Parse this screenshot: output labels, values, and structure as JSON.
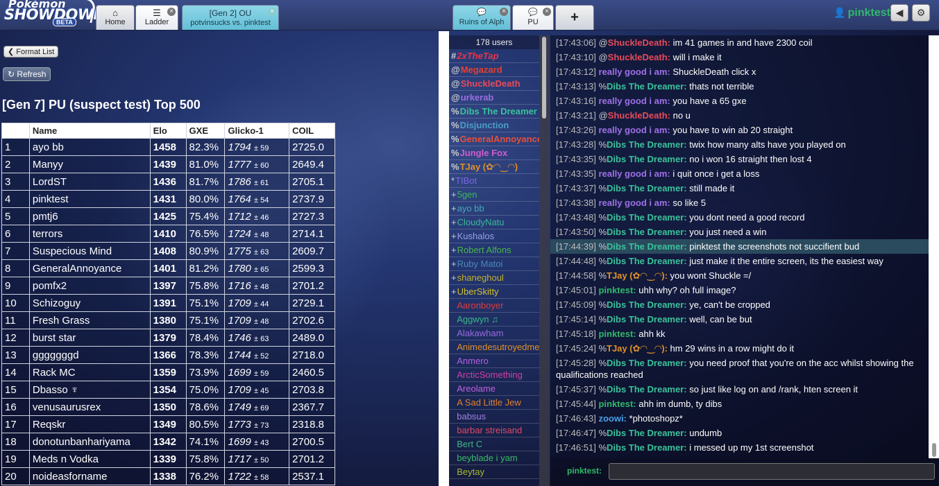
{
  "header": {
    "logo_line1": "Pokémon",
    "logo_line2": "SHOWDOWN",
    "logo_badge": "BETA",
    "tabs": [
      {
        "label": "Home",
        "icon": "⌂"
      },
      {
        "label": "Ladder",
        "icon": "☰"
      },
      {
        "label_top": "[Gen 2] OU",
        "label_bottom": "potvinsucks vs. pinktest"
      },
      {
        "label": "Ruins of Alph",
        "icon": "💬"
      },
      {
        "label": "PU",
        "icon": "💬"
      },
      {
        "icon": "+"
      }
    ],
    "username": "pinktest"
  },
  "ladder": {
    "format_list": "Format List",
    "refresh": "Refresh",
    "title": "[Gen 7] PU (suspect test) Top 500",
    "columns": [
      "",
      "Name",
      "Elo",
      "GXE",
      "Glicko-1",
      "COIL"
    ],
    "rows": [
      [
        "1",
        "ayo bb",
        "1458",
        "82.3%",
        "1794",
        "± 59",
        "2725.0"
      ],
      [
        "2",
        "Manyy",
        "1439",
        "81.0%",
        "1777",
        "± 60",
        "2649.4"
      ],
      [
        "3",
        "LordST",
        "1436",
        "81.7%",
        "1786",
        "± 61",
        "2705.1"
      ],
      [
        "4",
        "pinktest",
        "1431",
        "80.0%",
        "1764",
        "± 54",
        "2737.9"
      ],
      [
        "5",
        "pmtj6",
        "1425",
        "75.4%",
        "1712",
        "± 46",
        "2727.3"
      ],
      [
        "6",
        "terrors",
        "1410",
        "76.5%",
        "1724",
        "± 48",
        "2714.1"
      ],
      [
        "7",
        "Suspecious Mind",
        "1408",
        "80.9%",
        "1775",
        "± 63",
        "2609.7"
      ],
      [
        "8",
        "GeneralAnnoyance",
        "1401",
        "81.2%",
        "1780",
        "± 65",
        "2599.3"
      ],
      [
        "9",
        "pomfx2",
        "1397",
        "75.8%",
        "1716",
        "± 48",
        "2701.2"
      ],
      [
        "10",
        "Schizoguy",
        "1391",
        "75.1%",
        "1709",
        "± 44",
        "2729.1"
      ],
      [
        "11",
        "Fresh Grass",
        "1380",
        "75.1%",
        "1709",
        "± 48",
        "2702.6"
      ],
      [
        "12",
        "burst star",
        "1379",
        "78.4%",
        "1746",
        "± 63",
        "2489.0"
      ],
      [
        "13",
        "gggggggd",
        "1366",
        "78.3%",
        "1744",
        "± 52",
        "2718.0"
      ],
      [
        "14",
        "Rack MC",
        "1359",
        "73.9%",
        "1699",
        "± 59",
        "2460.5"
      ],
      [
        "15",
        "Dbasso ♆",
        "1354",
        "75.0%",
        "1709",
        "± 45",
        "2703.8"
      ],
      [
        "16",
        "venusaurusrex",
        "1350",
        "78.6%",
        "1749",
        "± 69",
        "2367.7"
      ],
      [
        "17",
        "Reqskr",
        "1349",
        "80.5%",
        "1773",
        "± 73",
        "2318.8"
      ],
      [
        "18",
        "donotunbanhariyama",
        "1342",
        "74.1%",
        "1699",
        "± 43",
        "2700.5"
      ],
      [
        "19",
        "Meds n Vodka",
        "1339",
        "75.8%",
        "1717",
        "± 50",
        "2701.2"
      ],
      [
        "20",
        "noideasforname",
        "1338",
        "76.2%",
        "1722",
        "± 58",
        "2537.1"
      ]
    ]
  },
  "userlist": {
    "count": "178 users",
    "users": [
      {
        "g": "#",
        "n": "2xTheTap",
        "c": "#e8334a",
        "b": true,
        "i": true
      },
      {
        "g": "@",
        "n": "Megazard",
        "c": "#e8402e",
        "b": true
      },
      {
        "g": "@",
        "n": "ShuckleDeath",
        "c": "#e84a5a",
        "b": true
      },
      {
        "g": "@",
        "n": "urkerab",
        "c": "#9b6ee0",
        "b": true
      },
      {
        "g": "%",
        "n": "Dibs The Dreamer",
        "c": "#3ac29a",
        "b": true
      },
      {
        "g": "%",
        "n": "Disjunction",
        "c": "#4a9ec8",
        "b": true
      },
      {
        "g": "%",
        "n": "GeneralAnnoyance",
        "c": "#e8503a",
        "b": true
      },
      {
        "g": "%",
        "n": "Jungle Fox",
        "c": "#d45ad0",
        "b": true
      },
      {
        "g": "%",
        "n": "TJay (✿◠‿◠)",
        "c": "#e0902a",
        "b": true
      },
      {
        "g": "*",
        "n": "TIBot",
        "c": "#7a6ae0"
      },
      {
        "g": "+",
        "n": "5gen",
        "c": "#3ab85a"
      },
      {
        "g": "+",
        "n": "ayo bb",
        "c": "#4aa8b8"
      },
      {
        "g": "+",
        "n": "CloudyNatu",
        "c": "#3ab898"
      },
      {
        "g": "+",
        "n": "Kushalos",
        "c": "#9aa0e8"
      },
      {
        "g": "+",
        "n": "Robert Alfons",
        "c": "#48b848"
      },
      {
        "g": "+",
        "n": "Ruby Matoi",
        "c": "#4a8ab8"
      },
      {
        "g": "+",
        "n": "shaneghoul",
        "c": "#c0b030"
      },
      {
        "g": "+",
        "n": "UberSkitty",
        "c": "#d0c030"
      },
      {
        "g": "",
        "n": "Aaronboyer",
        "c": "#e03a3a"
      },
      {
        "g": "",
        "n": "Aggwyn ♫",
        "c": "#3ab88a"
      },
      {
        "g": "",
        "n": "Alakawham",
        "c": "#9a6ae0"
      },
      {
        "g": "",
        "n": "Animedesutroyedme",
        "c": "#e0902a"
      },
      {
        "g": "",
        "n": "Anmero",
        "c": "#b060e0"
      },
      {
        "g": "",
        "n": "ArcticSomething",
        "c": "#d040a0"
      },
      {
        "g": "",
        "n": "Areolame",
        "c": "#c060e0"
      },
      {
        "g": "",
        "n": "A Sad Little Jew",
        "c": "#e08030"
      },
      {
        "g": "",
        "n": "babsus",
        "c": "#a080e0"
      },
      {
        "g": "",
        "n": "barbar streisand",
        "c": "#e04a6a"
      },
      {
        "g": "",
        "n": "Bert C",
        "c": "#3ab88a"
      },
      {
        "g": "",
        "n": "beyblade i yam",
        "c": "#3ab868"
      },
      {
        "g": "",
        "n": "Beytay",
        "c": "#a8b830"
      }
    ]
  },
  "chat": {
    "input_label": "pinktest:",
    "lines": [
      [
        "[17:43:06]",
        "@",
        "ShuckleDeath:",
        "im 41 games in and have 2300 coil",
        "#e84a5a",
        false
      ],
      [
        "[17:43:10]",
        "@",
        "ShuckleDeath:",
        "will i make it",
        "#e84a5a",
        false
      ],
      [
        "[17:43:12]",
        "",
        "really good i am:",
        "ShuckleDeath click x",
        "#a070e8",
        false
      ],
      [
        "[17:43:13]",
        "%",
        "Dibs The Dreamer:",
        "thats not terrible",
        "#3ac29a",
        false
      ],
      [
        "[17:43:16]",
        "",
        "really good i am:",
        "you have a 65 gxe",
        "#a070e8",
        false
      ],
      [
        "[17:43:21]",
        "@",
        "ShuckleDeath:",
        "no u",
        "#e84a5a",
        false
      ],
      [
        "[17:43:26]",
        "",
        "really good i am:",
        "you have to win ab 20 straight",
        "#a070e8",
        false
      ],
      [
        "[17:43:28]",
        "%",
        "Dibs The Dreamer:",
        "twix how many alts have you played on",
        "#3ac29a",
        false
      ],
      [
        "[17:43:35]",
        "%",
        "Dibs The Dreamer:",
        "no i won 16 straight then lost 4",
        "#3ac29a",
        false
      ],
      [
        "[17:43:35]",
        "",
        "really good i am:",
        "i quit once i get a loss",
        "#a070e8",
        false
      ],
      [
        "[17:43:37]",
        "%",
        "Dibs The Dreamer:",
        "still made it",
        "#3ac29a",
        false
      ],
      [
        "[17:43:38]",
        "",
        "really good i am:",
        "so like 5",
        "#a070e8",
        false
      ],
      [
        "[17:43:48]",
        "%",
        "Dibs The Dreamer:",
        "you dont need a good record",
        "#3ac29a",
        false
      ],
      [
        "[17:43:50]",
        "%",
        "Dibs The Dreamer:",
        "you just need a win",
        "#3ac29a",
        false
      ],
      [
        "[17:44:39]",
        "%",
        "Dibs The Dreamer:",
        "pinktest the screenshots not succifient bud",
        "#3ac29a",
        true
      ],
      [
        "[17:44:48]",
        "%",
        "Dibs The Dreamer:",
        "just make it the entire screen, its the easiest way",
        "#3ac29a",
        false
      ],
      [
        "[17:44:58]",
        "%",
        "TJay (✿◠‿◠):",
        "you wont Shuckle =/",
        "#e0902a",
        false
      ],
      [
        "[17:45:01]",
        "",
        "pinktest:",
        "uhh why? oh full image?",
        "#2fb86a",
        false
      ],
      [
        "[17:45:09]",
        "%",
        "Dibs The Dreamer:",
        "ye, can't be cropped",
        "#3ac29a",
        false
      ],
      [
        "[17:45:14]",
        "%",
        "Dibs The Dreamer:",
        "well, can be but",
        "#3ac29a",
        false
      ],
      [
        "[17:45:18]",
        "",
        "pinktest:",
        "ahh kk",
        "#2fb86a",
        false
      ],
      [
        "[17:45:24]",
        "%",
        "TJay (✿◠‿◠):",
        "hm 29 wins in a row might do it",
        "#e0902a",
        false
      ],
      [
        "[17:45:28]",
        "%",
        "Dibs The Dreamer:",
        "you need proof that you're on the acc whilst showing the qualifications reached",
        "#3ac29a",
        false
      ],
      [
        "[17:45:37]",
        "%",
        "Dibs The Dreamer:",
        "so just like log on and /rank, hten screen it",
        "#3ac29a",
        false
      ],
      [
        "[17:45:44]",
        "",
        "pinktest:",
        "ahh im dumb, ty dibs",
        "#2fb86a",
        false
      ],
      [
        "[17:46:43]",
        "",
        "zoowi:",
        "*photoshopz*",
        "#4aa0e8",
        false
      ],
      [
        "[17:46:47]",
        "%",
        "Dibs The Dreamer:",
        "undumb",
        "#3ac29a",
        false
      ],
      [
        "[17:46:51]",
        "%",
        "Dibs The Dreamer:",
        "i messed up my 1st screenshot",
        "#3ac29a",
        false
      ]
    ]
  }
}
